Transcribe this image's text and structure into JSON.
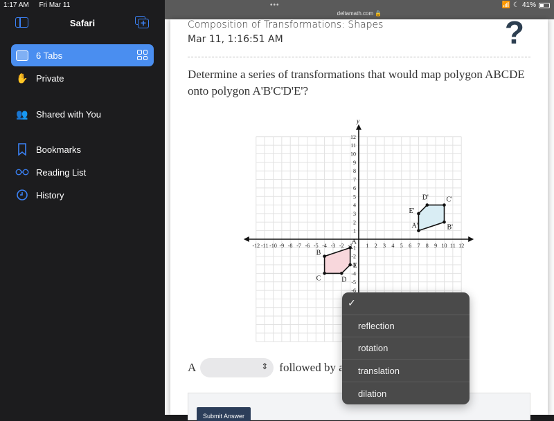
{
  "status_bar": {
    "time": "1:17 AM",
    "date": "Fri Mar 11",
    "battery": "41%"
  },
  "sidebar": {
    "title": "Safari",
    "items": [
      {
        "label": "6 Tabs",
        "icon": "tabs-icon",
        "active": true
      },
      {
        "label": "Private",
        "icon": "hand-icon"
      },
      {
        "label": "Shared with You",
        "icon": "shared-people-icon"
      },
      {
        "label": "Bookmarks",
        "icon": "bookmark-icon"
      },
      {
        "label": "Reading List",
        "icon": "glasses-icon"
      },
      {
        "label": "History",
        "icon": "clock-icon"
      }
    ]
  },
  "browser": {
    "dots": "•••",
    "url": "deltamath.com 🔒"
  },
  "assignment": {
    "title": "Composition of Transformations: Shapes",
    "date": "Mar 11, 1:16:51 AM",
    "help": "?",
    "question": "Determine a series of transformations that would map polygon ABCDE onto polygon A'B'C'D'E'?"
  },
  "answer": {
    "prefix": "A",
    "first_select_value": "",
    "middle": "followed by a",
    "submit_label": "Submit Answer"
  },
  "dropdown": {
    "selected_mark": "✓",
    "options": [
      "reflection",
      "rotation",
      "translation",
      "dilation"
    ]
  },
  "chart_data": {
    "type": "scatter",
    "xlabel": "x",
    "ylabel": "y",
    "xlim": [
      -12,
      12
    ],
    "ylim": [
      -12,
      12
    ],
    "grid": true,
    "x_ticks": [
      -12,
      -11,
      -10,
      -9,
      -8,
      -7,
      -6,
      -5,
      -4,
      -3,
      -2,
      -1,
      1,
      2,
      3,
      4,
      5,
      6,
      7,
      8,
      9,
      10,
      11,
      12
    ],
    "y_ticks": [
      12,
      11,
      10,
      9,
      8,
      7,
      6,
      5,
      4,
      3,
      2,
      1,
      -1,
      -2,
      -3,
      -4,
      -5,
      -6
    ],
    "polygons": [
      {
        "name": "ABCDE",
        "fill": "#f8d7dc",
        "points": [
          {
            "label": "A",
            "x": -1,
            "y": -1
          },
          {
            "label": "B",
            "x": -4,
            "y": -2
          },
          {
            "label": "C",
            "x": -4,
            "y": -4
          },
          {
            "label": "D",
            "x": -2,
            "y": -4
          },
          {
            "label": "E",
            "x": -1,
            "y": -3
          }
        ]
      },
      {
        "name": "A'B'C'D'E'",
        "fill": "#d9edf4",
        "points": [
          {
            "label": "A'",
            "x": 7,
            "y": 1
          },
          {
            "label": "B'",
            "x": 10,
            "y": 2
          },
          {
            "label": "C'",
            "x": 10,
            "y": 4
          },
          {
            "label": "D'",
            "x": 8,
            "y": 4
          },
          {
            "label": "E'",
            "x": 7,
            "y": 3
          }
        ]
      }
    ]
  }
}
